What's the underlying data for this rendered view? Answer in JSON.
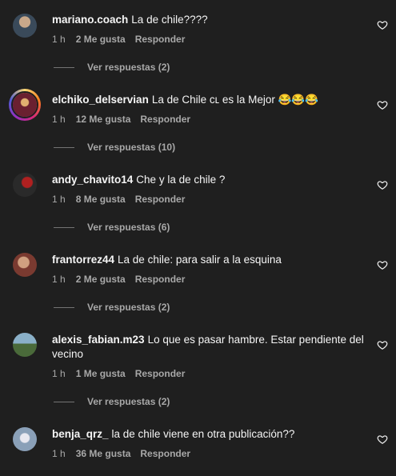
{
  "comments": [
    {
      "user": "mariano.coach",
      "text": "La de chile????",
      "time": "1 h",
      "likes": "2 Me gusta",
      "reply": "Responder",
      "replies": "Ver respuestas (2)",
      "avatar_color": "#5a6a7a"
    },
    {
      "user": "elchiko_delservian",
      "text": "La de Chile ᴄʟ es la Mejor 😂😂😂",
      "time": "1 h",
      "likes": "12 Me gusta",
      "reply": "Responder",
      "replies": "Ver respuestas (10)",
      "avatar_color": "#7a3040"
    },
    {
      "user": "andy_chavito14",
      "text": "Che y la de chile ?",
      "time": "1 h",
      "likes": "8 Me gusta",
      "reply": "Responder",
      "replies": "Ver respuestas (6)",
      "avatar_color": "#5a2a2a"
    },
    {
      "user": "frantorrez44",
      "text": "La de chile: para salir a la esquina",
      "time": "1 h",
      "likes": "2 Me gusta",
      "reply": "Responder",
      "replies": "Ver respuestas (2)",
      "avatar_color": "#8a5040"
    },
    {
      "user": "alexis_fabian.m23",
      "text": "Lo que es pasar hambre. Estar pendiente del vecino",
      "time": "1 h",
      "likes": "1 Me gusta",
      "reply": "Responder",
      "replies": "Ver respuestas (2)",
      "avatar_color": "#6a8a9a"
    },
    {
      "user": "benja_qrz_",
      "text": "la de chile viene en otra publicación??",
      "time": "1 h",
      "likes": "36 Me gusta",
      "reply": "Responder",
      "replies": "",
      "avatar_color": "#7a8a9a"
    }
  ]
}
